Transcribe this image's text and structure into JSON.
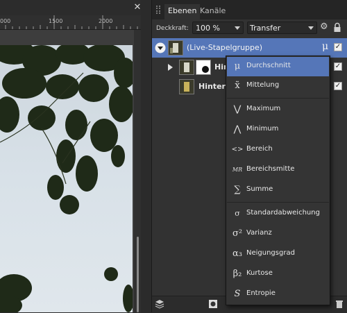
{
  "canvas": {
    "close_glyph": "✕",
    "ruler_labels": [
      "000",
      "1500",
      "2000"
    ]
  },
  "panel": {
    "tabs": [
      {
        "label": "Ebenen",
        "active": true
      },
      {
        "label": "Kanäle",
        "active": false
      }
    ],
    "opacity_label": "Deckkraft:",
    "opacity_value": "100 %",
    "blend_mode": "Transfer",
    "layers": [
      {
        "name": "(Live-Stapelgruppe)",
        "badge": "μ",
        "selected": true
      },
      {
        "name": "Hin",
        "selected": false
      },
      {
        "name": "Hinterg",
        "selected": false
      }
    ]
  },
  "menu": {
    "items": [
      {
        "icon": "μ",
        "label": "Durchschnitt",
        "highlight": true
      },
      {
        "icon": "x̃",
        "label": "Mittelung"
      },
      {
        "icon": "⋁",
        "label": "Maximum"
      },
      {
        "icon": "⋀",
        "label": "Minimum"
      },
      {
        "icon": "<>",
        "label": "Bereich"
      },
      {
        "icon": "MR",
        "label": "Bereichsmitte"
      },
      {
        "icon": "∑",
        "label": "Summe"
      },
      {
        "icon": "σ",
        "label": "Standardabweichung"
      },
      {
        "icon": "σ²",
        "label": "Varianz"
      },
      {
        "icon": "α₃",
        "label": "Neigungsgrad"
      },
      {
        "icon": "β₂",
        "label": "Kurtose"
      },
      {
        "icon": "S",
        "label": "Entropie"
      }
    ]
  },
  "colors": {
    "accent": "#5576b8",
    "panel_bg": "#323232",
    "menu_bg": "#343434"
  }
}
